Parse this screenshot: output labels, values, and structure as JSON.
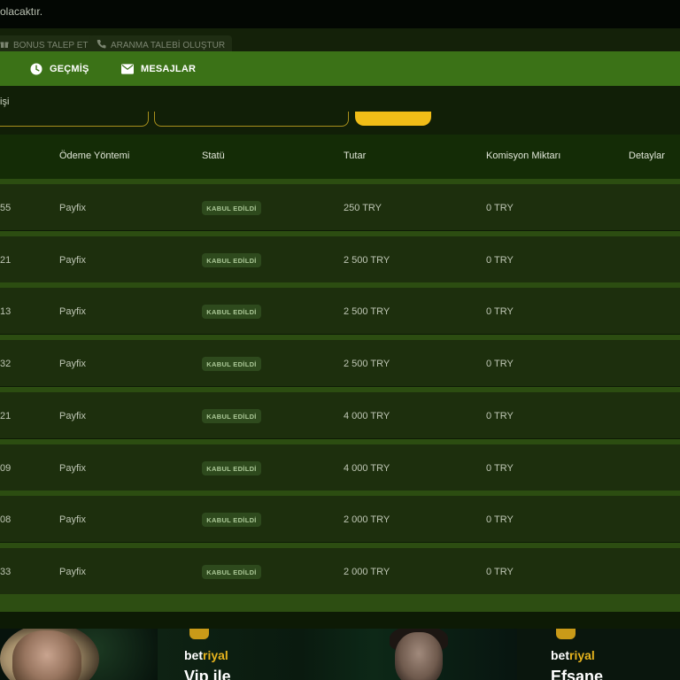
{
  "topbar": {
    "notice": "olacaktır."
  },
  "pills": {
    "bonus_label": "BONUS TALEP ET",
    "call_label": "ARANMA TALEBİ OLUŞTUR"
  },
  "nav": {
    "history_label": "GEÇMİŞ",
    "messages_label": "MESAJLAR"
  },
  "filter": {
    "label": "işi"
  },
  "table": {
    "headers": {
      "method": "Ödeme Yöntemi",
      "status": "Statü",
      "amount": "Tutar",
      "commission": "Komisyon Miktarı",
      "details": "Detaylar"
    },
    "rows": [
      {
        "id": "55",
        "method": "Payfix",
        "status": "KABUL EDİLDİ",
        "amount": "250 TRY",
        "commission": "0 TRY"
      },
      {
        "id": "21",
        "method": "Payfix",
        "status": "KABUL EDİLDİ",
        "amount": "2 500 TRY",
        "commission": "0 TRY"
      },
      {
        "id": "13",
        "method": "Payfix",
        "status": "KABUL EDİLDİ",
        "amount": "2 500 TRY",
        "commission": "0 TRY"
      },
      {
        "id": "32",
        "method": "Payfix",
        "status": "KABUL EDİLDİ",
        "amount": "2 500 TRY",
        "commission": "0 TRY"
      },
      {
        "id": "21",
        "method": "Payfix",
        "status": "KABUL EDİLDİ",
        "amount": "4 000 TRY",
        "commission": "0 TRY"
      },
      {
        "id": "09",
        "method": "Payfix",
        "status": "KABUL EDİLDİ",
        "amount": "4 000 TRY",
        "commission": "0 TRY"
      },
      {
        "id": "08",
        "method": "Payfix",
        "status": "KABUL EDİLDİ",
        "amount": "2 000 TRY",
        "commission": "0 TRY"
      },
      {
        "id": "33",
        "method": "Payfix",
        "status": "KABUL EDİLDİ",
        "amount": "2 000 TRY",
        "commission": "0 TRY"
      }
    ]
  },
  "banners": {
    "left_title": "Vip ile",
    "right_title": "Efsane",
    "brand_bet": "bet",
    "brand_riyal": "riyal"
  },
  "colors": {
    "nav_bg": "#3b7217",
    "accent_gold": "#f0bd17",
    "badge_bg": "#2e4a1d",
    "row_bg": "#1d2f0d"
  },
  "icons": {
    "history": "clock-icon",
    "messages": "mail-icon",
    "bonus": "gift-icon",
    "call": "phone-icon"
  }
}
